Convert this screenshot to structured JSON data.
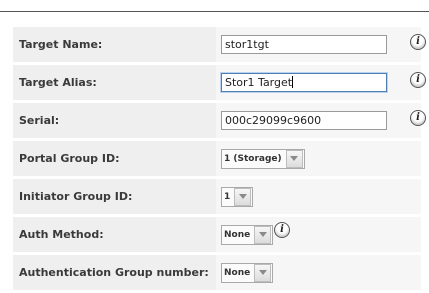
{
  "form": {
    "rows": [
      {
        "label": "Target Name:",
        "value": "stor1tgt"
      },
      {
        "label": "Target Alias:",
        "value": "Stor1 Target"
      },
      {
        "label": "Serial:",
        "value": "000c29099c9600"
      },
      {
        "label": "Portal Group ID:",
        "value": "1 (Storage)"
      },
      {
        "label": "Initiator Group ID:",
        "value": "1"
      },
      {
        "label": "Auth Method:",
        "value": "None"
      },
      {
        "label": "Authentication Group number:",
        "value": "None"
      }
    ]
  },
  "icons": {
    "info": "info-icon",
    "dropdown": "chevron-down-icon"
  },
  "colors": {
    "label_bg": "#efefef",
    "value_bg": "#f6f6f6",
    "focus_border": "#4f7fb0"
  }
}
